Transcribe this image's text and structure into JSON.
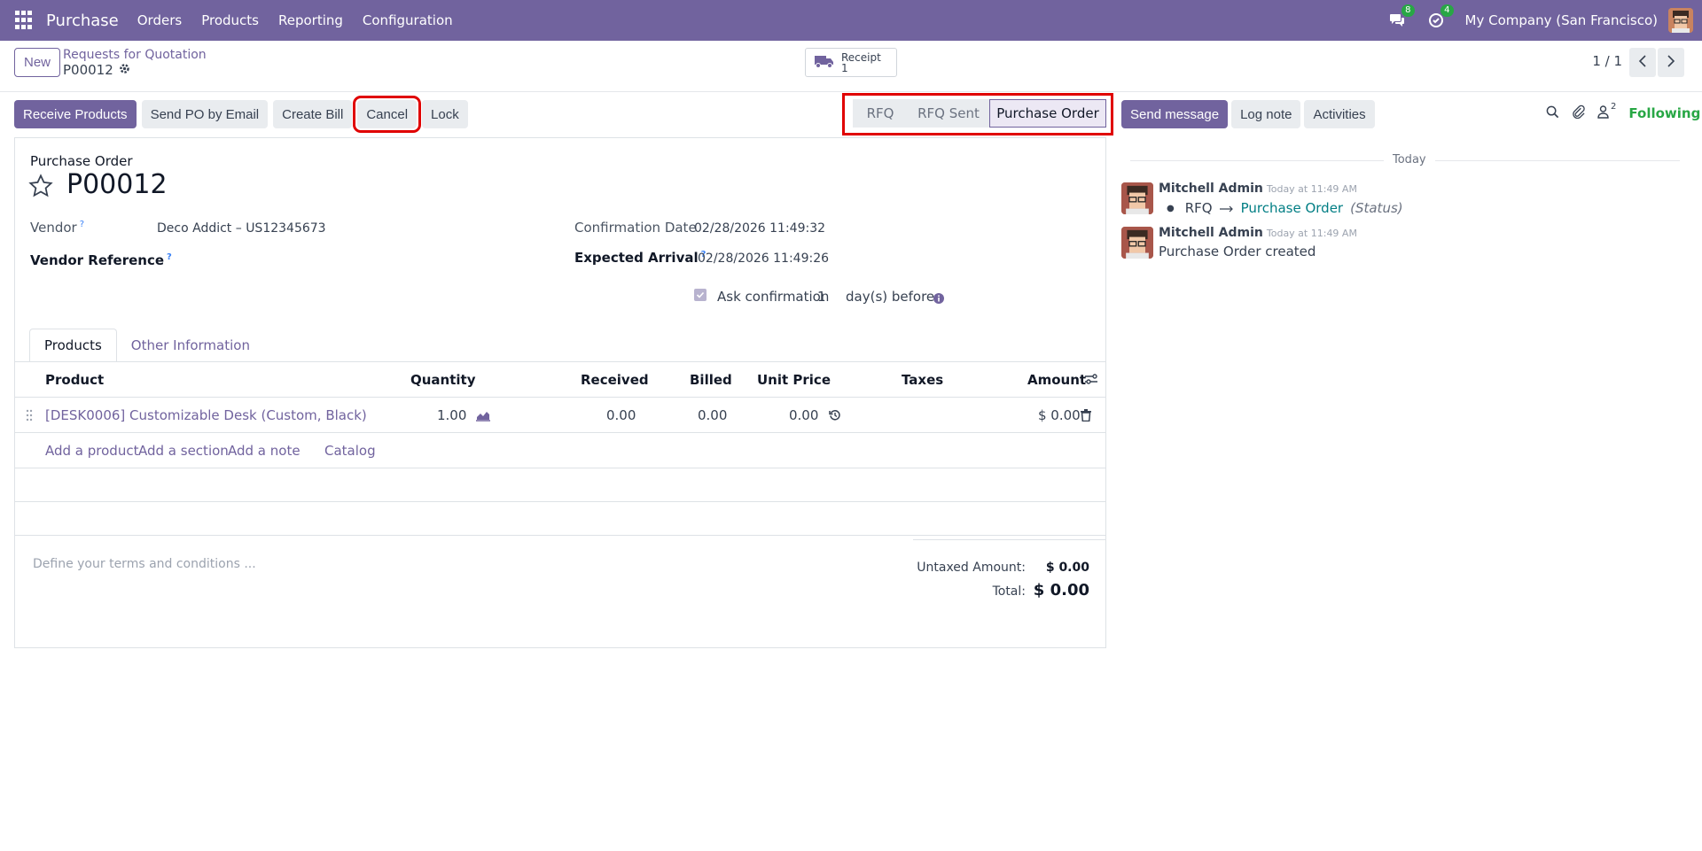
{
  "navbar": {
    "app_name": "Purchase",
    "menu": [
      "Orders",
      "Products",
      "Reporting",
      "Configuration"
    ],
    "messages_count": "8",
    "activities_count": "4",
    "company": "My Company (San Francisco)"
  },
  "control_panel": {
    "new_label": "New",
    "breadcrumb_parent": "Requests for Quotation",
    "breadcrumb_current": "P00012",
    "receipt_label": "Receipt",
    "receipt_count": "1",
    "pager": "1 / 1"
  },
  "actions": {
    "receive_products": "Receive Products",
    "send_po_email": "Send PO by Email",
    "create_bill": "Create Bill",
    "cancel": "Cancel",
    "lock": "Lock"
  },
  "status": {
    "stages": [
      "RFQ",
      "RFQ Sent",
      "Purchase Order"
    ],
    "active": "Purchase Order"
  },
  "chatter_buttons": {
    "send_message": "Send message",
    "log_note": "Log note",
    "activities": "Activities",
    "followers_count": "2",
    "following": "Following"
  },
  "form": {
    "title_label": "Purchase Order",
    "name": "P00012",
    "vendor_label": "Vendor",
    "vendor_value": "Deco Addict – US12345673",
    "vendor_ref_label": "Vendor Reference",
    "confirmation_date_label": "Confirmation Date",
    "confirmation_date_value": "02/28/2026 11:49:32",
    "expected_arrival_label": "Expected Arrival",
    "expected_arrival_value": "02/28/2026 11:49:26",
    "ask_confirmation_label": "Ask confirmation",
    "ask_confirmation_days": "1",
    "ask_confirmation_suffix": "day(s) before",
    "ask_confirmation_checked": true
  },
  "tabs": [
    "Products",
    "Other Information"
  ],
  "table": {
    "columns": [
      "Product",
      "Quantity",
      "Received",
      "Billed",
      "Unit Price",
      "Taxes",
      "Amount"
    ],
    "rows": [
      {
        "product": "[DESK0006] Customizable Desk (Custom, Black)",
        "quantity": "1.00",
        "received": "0.00",
        "billed": "0.00",
        "unit_price": "0.00",
        "taxes": "",
        "amount": "$ 0.00"
      }
    ],
    "add_links": [
      "Add a product",
      "Add a section",
      "Add a note",
      "Catalog"
    ]
  },
  "terms_placeholder": "Define your terms and conditions ...",
  "totals": {
    "untaxed_label": "Untaxed Amount:",
    "untaxed_value": "$ 0.00",
    "total_label": "Total:",
    "total_value": "$ 0.00"
  },
  "chatter": {
    "date_separator": "Today",
    "messages": [
      {
        "author": "Mitchell Admin",
        "time": "Today at 11:49 AM",
        "from": "RFQ",
        "to": "Purchase Order",
        "field": "(Status)"
      },
      {
        "author": "Mitchell Admin",
        "time": "Today at 11:49 AM",
        "body": "Purchase Order created"
      }
    ]
  },
  "colors": {
    "brand": "#71639e",
    "highlight": "#e00000",
    "following": "#28a745",
    "link": "#017e84"
  }
}
